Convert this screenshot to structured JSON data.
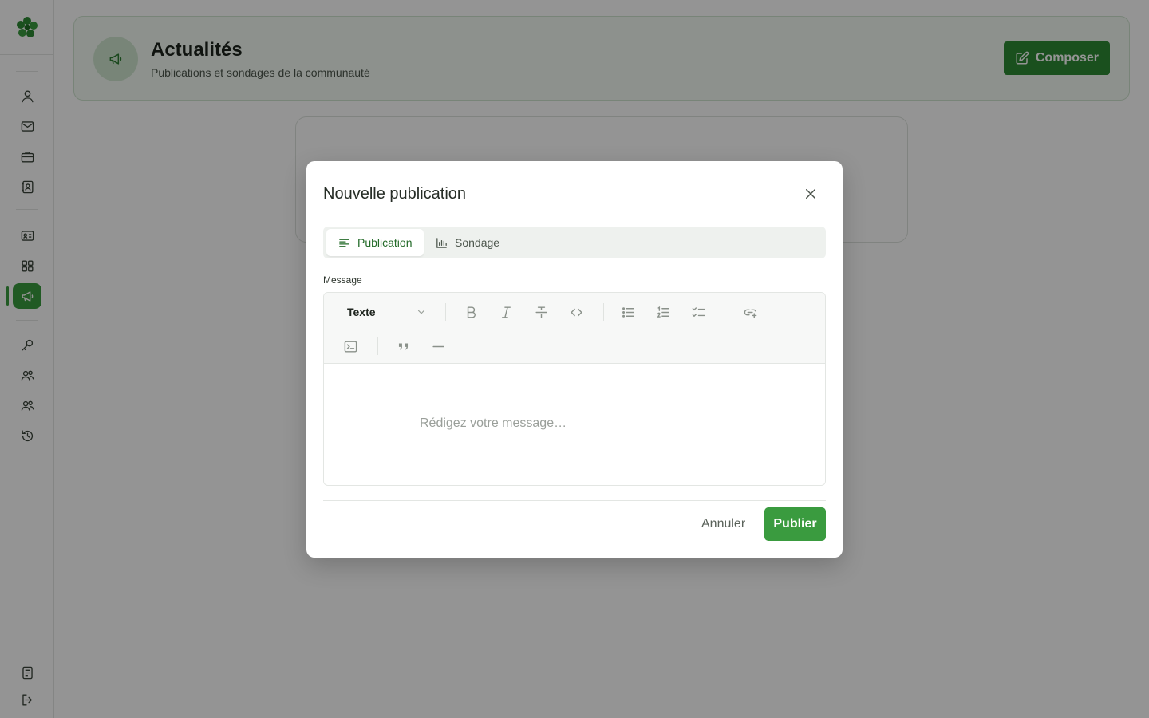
{
  "app": {
    "logo_icon": "clover-logo-icon",
    "accent": "#3a9b3f"
  },
  "sidebar": {
    "items": [
      {
        "icon": "user-icon"
      },
      {
        "icon": "mail-icon"
      },
      {
        "icon": "briefcase-icon"
      },
      {
        "icon": "contact-book-icon"
      },
      {
        "icon": "id-card-icon"
      },
      {
        "icon": "grid-icon"
      },
      {
        "icon": "megaphone-icon",
        "active": true
      },
      {
        "icon": "key-icon"
      },
      {
        "icon": "users-icon"
      },
      {
        "icon": "users-icon"
      },
      {
        "icon": "history-icon"
      }
    ],
    "bottom_items": [
      {
        "icon": "document-icon"
      },
      {
        "icon": "logout-icon"
      }
    ]
  },
  "header": {
    "title": "Actualités",
    "subtitle": "Publications et sondages de la communauté",
    "compose_label": "Composer"
  },
  "modal": {
    "title": "Nouvelle publication",
    "tabs": [
      {
        "label": "Publication",
        "icon": "text-align-icon",
        "active": true
      },
      {
        "label": "Sondage",
        "icon": "bar-chart-icon",
        "active": false
      }
    ],
    "message_label": "Message",
    "editor": {
      "block_type": "Texte",
      "placeholder": "Rédigez votre message…"
    },
    "cancel_label": "Annuler",
    "publish_label": "Publier"
  }
}
